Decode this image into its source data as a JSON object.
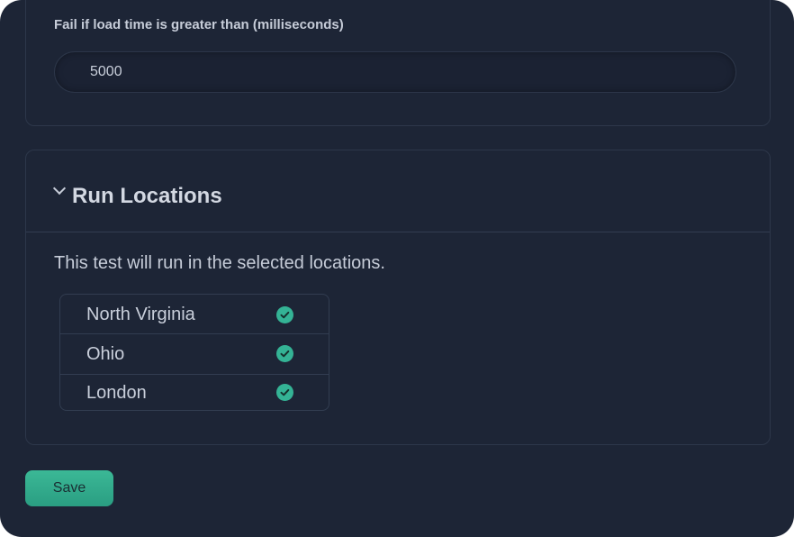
{
  "load_time": {
    "label": "Fail if load time is greater than (milliseconds)",
    "value": "5000"
  },
  "run_locations": {
    "title": "Run Locations",
    "expanded": true,
    "description": "This test will run in the selected locations.",
    "locations": [
      {
        "name": "North Virginia",
        "selected": true
      },
      {
        "name": "Ohio",
        "selected": true
      },
      {
        "name": "London",
        "selected": true
      }
    ]
  },
  "actions": {
    "save_label": "Save"
  },
  "colors": {
    "background": "#1d2536",
    "accent": "#34b395",
    "text": "#c6ccd8",
    "border": "#2d374a"
  }
}
